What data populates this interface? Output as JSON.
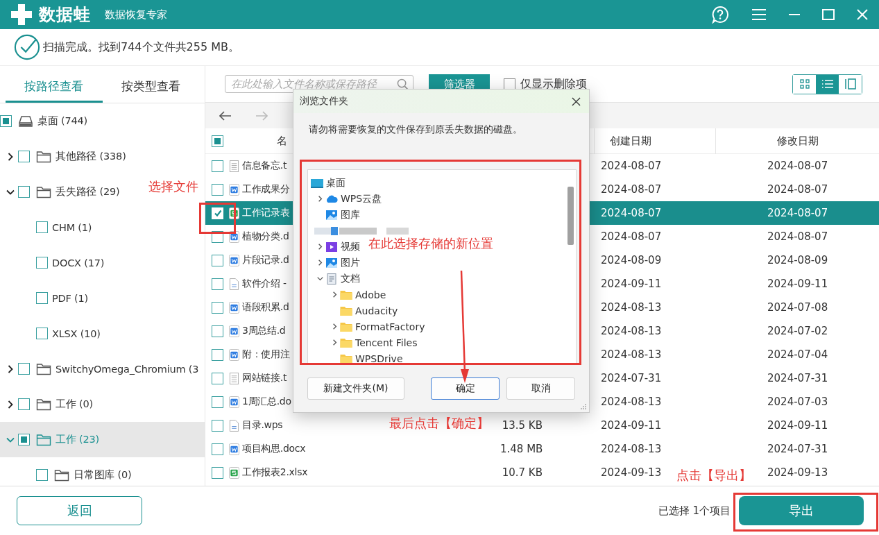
{
  "app": {
    "name": "数据蛙",
    "subtitle": "数据恢复专家"
  },
  "scan_status": "扫描完成。找到744个文件共255 MB。",
  "view_tabs": [
    {
      "label": "按路径查看",
      "selected": true
    },
    {
      "label": "按类型查看",
      "selected": false
    }
  ],
  "tree": [
    {
      "label": "桌面 (744)",
      "kind": "drive",
      "checked": true,
      "selected": false,
      "children": [
        {
          "label": "其他路径 (338)",
          "kind": "folder",
          "checked": false,
          "selected": false,
          "expanded": false
        },
        {
          "label": "丢失路径 (29)",
          "kind": "folder",
          "checked": false,
          "selected": false,
          "expanded": true,
          "children": [
            {
              "label": "CHM (1)",
              "kind": "type",
              "checked": false,
              "selected": false
            },
            {
              "label": "DOCX (17)",
              "kind": "type",
              "checked": false,
              "selected": false
            },
            {
              "label": "PDF (1)",
              "kind": "type",
              "checked": false,
              "selected": false
            },
            {
              "label": "XLSX (10)",
              "kind": "type",
              "checked": false,
              "selected": false
            }
          ]
        },
        {
          "label": "SwitchyOmega_Chromium (3",
          "kind": "folder",
          "checked": false,
          "selected": false,
          "expanded": false
        },
        {
          "label": "工作 (0)",
          "kind": "folder",
          "checked": false,
          "selected": false,
          "expanded": false
        },
        {
          "label": "工作 (23)",
          "kind": "folder",
          "checked": true,
          "selected": true,
          "expanded": true,
          "children": [
            {
              "label": "日常图库 (0)",
              "kind": "folder",
              "checked": false,
              "selected": false
            }
          ]
        }
      ]
    }
  ],
  "search": {
    "placeholder": "在此处输入文件名称或保存路径"
  },
  "filter_button": "筛选器",
  "deleted_only": {
    "label": "仅显示删除项",
    "checked": false
  },
  "view_modes": [
    {
      "kind": "grid",
      "selected": false
    },
    {
      "kind": "list",
      "selected": true
    },
    {
      "kind": "preview",
      "selected": false
    }
  ],
  "table": {
    "select_all_checked": true,
    "header": {
      "name": "名",
      "created": "创建日期",
      "modified": "修改日期"
    },
    "rows": [
      {
        "name": "信息备忘.t",
        "kind": "text",
        "checked": false,
        "selected": false,
        "created": "2024-08-07",
        "modified": "2024-08-07"
      },
      {
        "name": "工作成果分",
        "kind": "word",
        "checked": false,
        "selected": false,
        "created": "2024-08-07",
        "modified": "2024-08-07"
      },
      {
        "name": "工作记录表",
        "kind": "sheet",
        "checked": true,
        "selected": true,
        "created": "2024-08-07",
        "modified": "2024-08-07"
      },
      {
        "name": "植物分类.d",
        "kind": "word",
        "checked": false,
        "selected": false,
        "created": "2024-08-07",
        "modified": "2024-08-07"
      },
      {
        "name": "片段记录.d",
        "kind": "word",
        "checked": false,
        "selected": false,
        "created": "2024-08-09",
        "modified": "2024-08-09"
      },
      {
        "name": "软件介绍 -",
        "kind": "plain",
        "checked": false,
        "selected": false,
        "created": "2024-09-11",
        "modified": "2024-09-11"
      },
      {
        "name": "语段积累.d",
        "kind": "word",
        "checked": false,
        "selected": false,
        "created": "2024-08-13",
        "modified": "2024-07-08"
      },
      {
        "name": "3周总结.d",
        "kind": "word",
        "checked": false,
        "selected": false,
        "created": "2024-08-13",
        "modified": "2024-07-02"
      },
      {
        "name": "附：使用注",
        "kind": "word",
        "checked": false,
        "selected": false,
        "created": "2024-08-13",
        "modified": "2024-07-04"
      },
      {
        "name": "网站链接.t",
        "kind": "text",
        "checked": false,
        "selected": false,
        "created": "2024-07-31",
        "modified": "2024-07-31"
      },
      {
        "name": "1周汇总.do",
        "kind": "word",
        "checked": false,
        "selected": false,
        "created": "2024-08-13",
        "modified": "2024-07-03"
      },
      {
        "name": "目录.wps",
        "kind": "plain",
        "checked": false,
        "selected": false,
        "size": "13.5 KB",
        "created": "2024-09-11",
        "modified": "2024-09-11"
      },
      {
        "name": "项目构思.docx",
        "kind": "word",
        "checked": false,
        "selected": false,
        "size": "1.48 MB",
        "created": "2024-08-13",
        "modified": "2024-07-31"
      },
      {
        "name": "工作报表2.xlsx",
        "kind": "sheet",
        "checked": false,
        "selected": false,
        "size": "10.7 KB",
        "created": "2024-09-13",
        "modified": "2024-09-13"
      }
    ]
  },
  "dialog": {
    "title": "浏览文件夹",
    "message": "请勿将需要恢复的文件保存到原丢失数据的磁盘。",
    "tree": [
      {
        "label": "桌面",
        "kind": "desktop",
        "children": [
          {
            "label": "WPS云盘",
            "kind": "cloud",
            "expanded": false
          },
          {
            "label": "图库",
            "kind": "gallery"
          },
          {
            "kind": "blurred"
          },
          {
            "label": "视频",
            "kind": "video",
            "expanded": false
          },
          {
            "label": "图片",
            "kind": "pictures",
            "expanded": false
          },
          {
            "label": "文档",
            "kind": "documents",
            "expanded": true,
            "children": [
              {
                "label": "Adobe",
                "kind": "folder",
                "expanded": false
              },
              {
                "label": "Audacity",
                "kind": "folder"
              },
              {
                "label": "FormatFactory",
                "kind": "folder",
                "expanded": false
              },
              {
                "label": "Tencent Files",
                "kind": "folder",
                "expanded": false
              },
              {
                "label": "WPSDrive",
                "kind": "folder"
              }
            ]
          }
        ]
      }
    ],
    "buttons": [
      {
        "label": "新建文件夹(M)",
        "kind": "new_folder"
      },
      {
        "label": "确定",
        "kind": "ok"
      },
      {
        "label": "取消",
        "kind": "cancel"
      }
    ]
  },
  "footer": {
    "back_button": "返回",
    "selection_info": "已选择 1个项目",
    "export_button": "导出"
  },
  "annotations": [
    {
      "kind": "box"
    },
    {
      "kind": "label",
      "text": "选择文件"
    },
    {
      "kind": "box"
    },
    {
      "kind": "label",
      "text": "在此选择存储的新位置"
    },
    {
      "kind": "arrow"
    },
    {
      "kind": "label",
      "text": "最后点击【确定】"
    },
    {
      "kind": "label",
      "text": "点击【导出】"
    },
    {
      "kind": "box"
    }
  ]
}
